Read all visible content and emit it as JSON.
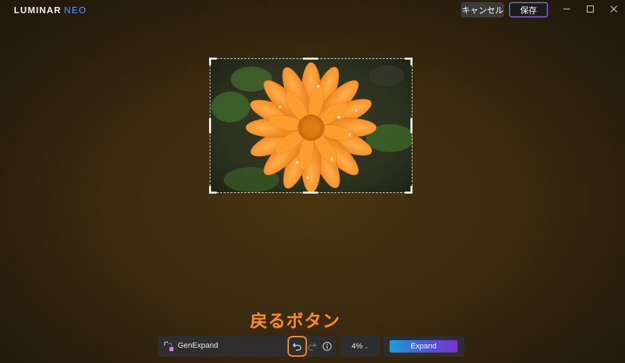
{
  "app": {
    "logo_main": "LUMINAR",
    "logo_sub": "NEO"
  },
  "header": {
    "cancel_label": "キャンセル",
    "save_label": "保存"
  },
  "annotation": {
    "text": "戻るボタン",
    "color": "#ff8c1a"
  },
  "toolbar": {
    "tool_name": "GenExpand",
    "zoom_label": "4%",
    "expand_label": "Expand"
  },
  "colors": {
    "accent_orange": "#ff8c1a",
    "expand_gradient_start": "#1a9fd6",
    "expand_gradient_end": "#7b35c8"
  },
  "icons": [
    "genexpand-icon",
    "undo-icon",
    "redo-icon",
    "info-icon",
    "chevron-down-icon",
    "minimize-icon",
    "maximize-icon",
    "close-icon"
  ]
}
